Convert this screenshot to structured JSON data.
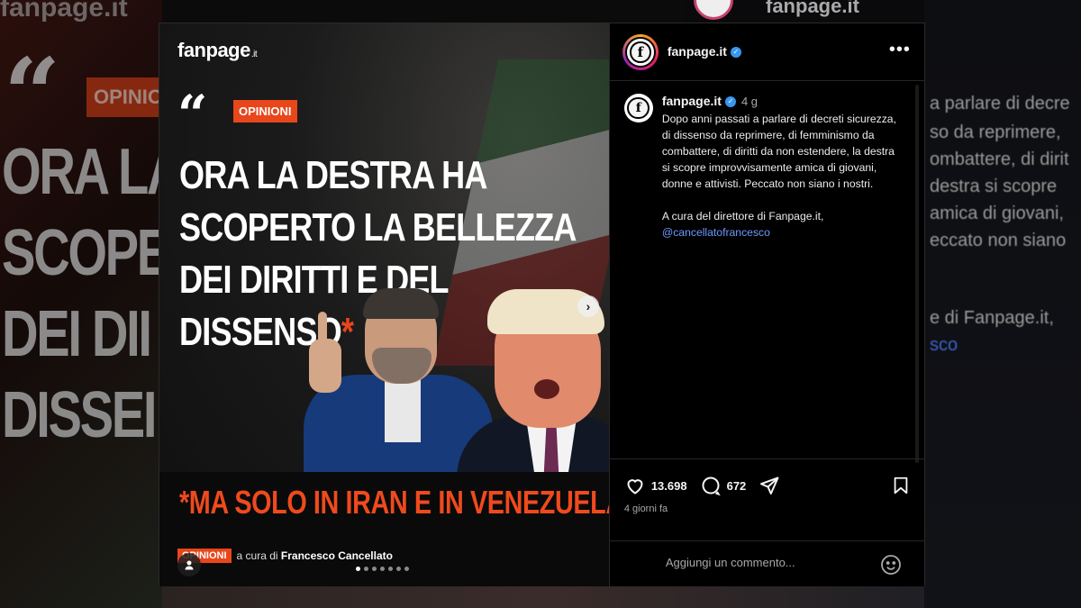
{
  "media": {
    "brand": "fanpage",
    "brand_tld": ".it",
    "badge": "OPINIONI",
    "headline_lines": [
      "ORA LA DESTRA HA",
      "SCOPERTO LA BELLEZZA",
      "DEI DIRITTI E DEL",
      "DISSENSO"
    ],
    "headline_asterisk": "*",
    "subline": "*MA SOLO IN IRAN E IN VENEZUELA",
    "footer_badge": "OPINIONI",
    "footer_prefix": "a cura di",
    "footer_author": "Francesco Cancellato",
    "carousel_total": 7,
    "carousel_active": 1,
    "accent": "#e8461b"
  },
  "post": {
    "username": "fanpage.it",
    "verified": true,
    "more_label": "•••"
  },
  "caption": {
    "username": "fanpage.it",
    "time": "4 g",
    "text": "Dopo anni passati a parlare di decreti sicurezza, di dissenso da reprimere, di femminismo da combattere, di diritti da non estendere, la destra si scopre improvvisamente amica di giovani, donne e attivisti. Peccato non siano i nostri.",
    "credit": "A cura del direttore di Fanpage.it,",
    "mention": "@cancellatofrancesco",
    "mention_color": "#6c9aff"
  },
  "actions": {
    "likes": "13.698",
    "comments": "672",
    "date": "4 giorni fa"
  },
  "comment": {
    "placeholder": "Aggiungi un commento..."
  },
  "background": {
    "left_lines": [
      "ORA LA",
      "SCOPEI",
      "DEI DII",
      "DISSEI"
    ],
    "left_badge": "OPINIO",
    "left_brand": "fanpage.it",
    "right_lines": [
      "a parlare di decre",
      "so da reprimere,",
      "ombattere, di dirit",
      "destra si scopre",
      "amica di giovani,",
      "eccato non siano",
      "e di Fanpage.it,"
    ],
    "right_link": "sco",
    "top_name": "fanpage.it"
  }
}
